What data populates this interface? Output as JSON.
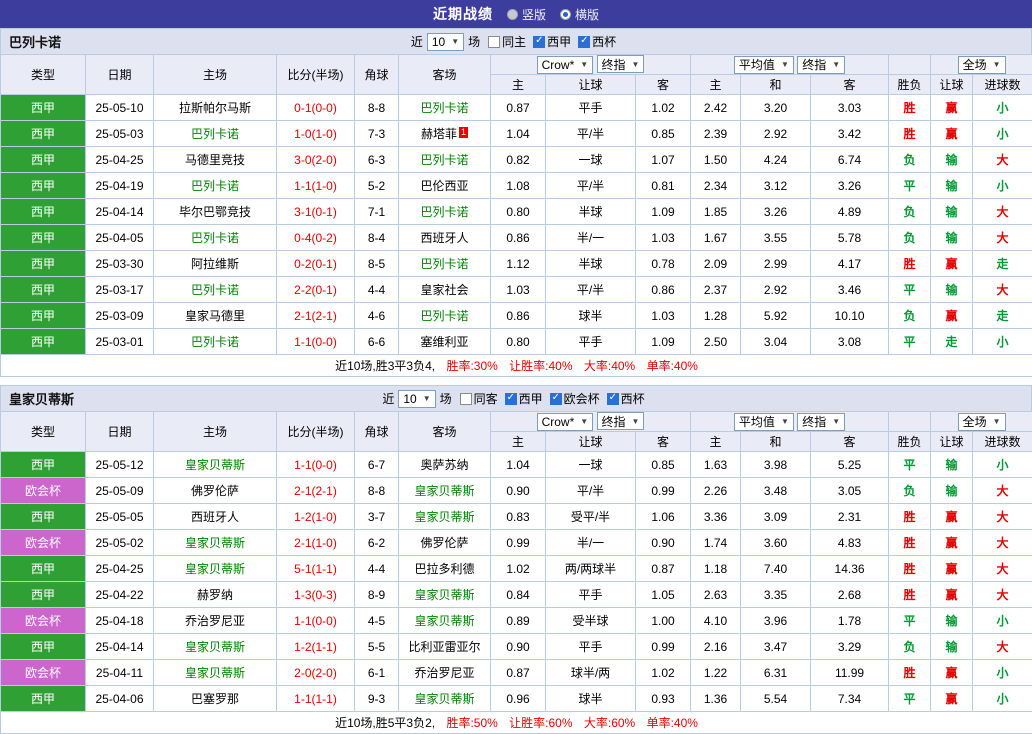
{
  "colors": {
    "topbar_bg": "#3d3d9e",
    "section_bar_bg": "#dde1ef",
    "header_bg": "#e9ebf7",
    "border": "#b8cce4",
    "league_green": "#2fa033",
    "league_purple": "#cc66cc",
    "focal_team": "#008000",
    "red": "#e60000",
    "green": "#009933"
  },
  "topbar": {
    "title": "近期战绩",
    "radios": [
      {
        "label": "竖版",
        "selected": false
      },
      {
        "label": "横版",
        "selected": true
      }
    ]
  },
  "sections": [
    {
      "team": "巴列卡诺",
      "filter": {
        "prefix": "近",
        "count": "10",
        "suffix": "场",
        "checkboxes": [
          {
            "label": "同主",
            "checked": false
          },
          {
            "label": "西甲",
            "checked": true
          },
          {
            "label": "西杯",
            "checked": true
          }
        ]
      },
      "header": {
        "cols": [
          "类型",
          "日期",
          "主场",
          "比分(半场)",
          "角球",
          "客场"
        ],
        "group1": {
          "select1": "Crow*",
          "select2": "终指",
          "cols": [
            "主",
            "让球",
            "客"
          ]
        },
        "group2": {
          "select1": "平均值",
          "select2": "终指",
          "cols": [
            "主",
            "和",
            "客"
          ]
        },
        "winlose": "胜负",
        "group3": {
          "select": "全场",
          "cols": [
            "让球",
            "进球数"
          ]
        }
      },
      "rows": [
        {
          "league": "西甲",
          "date": "25-05-10",
          "home": "拉斯帕尔马斯",
          "home_focal": false,
          "score": "0-1(0-0)",
          "corners": "8-8",
          "away": "巴列卡诺",
          "away_focal": true,
          "odds": [
            "0.87",
            "平手",
            "1.02"
          ],
          "avg": [
            "2.42",
            "3.20",
            "3.03"
          ],
          "result": "胜",
          "handicap": "赢",
          "goals": "小"
        },
        {
          "league": "西甲",
          "date": "25-05-03",
          "home": "巴列卡诺",
          "home_focal": true,
          "score": "1-0(1-0)",
          "corners": "7-3",
          "away": "赫塔菲",
          "away_focal": false,
          "away_card": "1",
          "odds": [
            "1.04",
            "平/半",
            "0.85"
          ],
          "avg": [
            "2.39",
            "2.92",
            "3.42"
          ],
          "result": "胜",
          "handicap": "赢",
          "goals": "小"
        },
        {
          "league": "西甲",
          "date": "25-04-25",
          "home": "马德里竞技",
          "home_focal": false,
          "score": "3-0(2-0)",
          "corners": "6-3",
          "away": "巴列卡诺",
          "away_focal": true,
          "odds": [
            "0.82",
            "一球",
            "1.07"
          ],
          "avg": [
            "1.50",
            "4.24",
            "6.74"
          ],
          "result": "负",
          "handicap": "输",
          "goals": "大"
        },
        {
          "league": "西甲",
          "date": "25-04-19",
          "home": "巴列卡诺",
          "home_focal": true,
          "score": "1-1(1-0)",
          "corners": "5-2",
          "away": "巴伦西亚",
          "away_focal": false,
          "odds": [
            "1.08",
            "平/半",
            "0.81"
          ],
          "avg": [
            "2.34",
            "3.12",
            "3.26"
          ],
          "result": "平",
          "handicap": "输",
          "goals": "小"
        },
        {
          "league": "西甲",
          "date": "25-04-14",
          "home": "毕尔巴鄂竞技",
          "home_focal": false,
          "score": "3-1(0-1)",
          "corners": "7-1",
          "away": "巴列卡诺",
          "away_focal": true,
          "odds": [
            "0.80",
            "半球",
            "1.09"
          ],
          "avg": [
            "1.85",
            "3.26",
            "4.89"
          ],
          "result": "负",
          "handicap": "输",
          "goals": "大"
        },
        {
          "league": "西甲",
          "date": "25-04-05",
          "home": "巴列卡诺",
          "home_focal": true,
          "score": "0-4(0-2)",
          "corners": "8-4",
          "away": "西班牙人",
          "away_focal": false,
          "odds": [
            "0.86",
            "半/一",
            "1.03"
          ],
          "avg": [
            "1.67",
            "3.55",
            "5.78"
          ],
          "result": "负",
          "handicap": "输",
          "goals": "大"
        },
        {
          "league": "西甲",
          "date": "25-03-30",
          "home": "阿拉维斯",
          "home_focal": false,
          "score": "0-2(0-1)",
          "corners": "8-5",
          "away": "巴列卡诺",
          "away_focal": true,
          "odds": [
            "1.12",
            "半球",
            "0.78"
          ],
          "avg": [
            "2.09",
            "2.99",
            "4.17"
          ],
          "result": "胜",
          "handicap": "赢",
          "goals": "走"
        },
        {
          "league": "西甲",
          "date": "25-03-17",
          "home": "巴列卡诺",
          "home_focal": true,
          "score": "2-2(0-1)",
          "corners": "4-4",
          "away": "皇家社会",
          "away_focal": false,
          "odds": [
            "1.03",
            "平/半",
            "0.86"
          ],
          "avg": [
            "2.37",
            "2.92",
            "3.46"
          ],
          "result": "平",
          "handicap": "输",
          "goals": "大"
        },
        {
          "league": "西甲",
          "date": "25-03-09",
          "home": "皇家马德里",
          "home_focal": false,
          "score": "2-1(2-1)",
          "corners": "4-6",
          "away": "巴列卡诺",
          "away_focal": true,
          "odds": [
            "0.86",
            "球半",
            "1.03"
          ],
          "avg": [
            "1.28",
            "5.92",
            "10.10"
          ],
          "result": "负",
          "handicap": "赢",
          "goals": "走"
        },
        {
          "league": "西甲",
          "date": "25-03-01",
          "home": "巴列卡诺",
          "home_focal": true,
          "score": "1-1(0-0)",
          "corners": "6-6",
          "away": "塞维利亚",
          "away_focal": false,
          "odds": [
            "0.80",
            "平手",
            "1.09"
          ],
          "avg": [
            "2.50",
            "3.04",
            "3.08"
          ],
          "result": "平",
          "handicap": "走",
          "goals": "小"
        }
      ],
      "footer": {
        "prefix": "近10场,胜3平3负4,",
        "stats": [
          "胜率:30%",
          "让胜率:40%",
          "大率:40%",
          "单率:40%"
        ]
      }
    },
    {
      "team": "皇家贝蒂斯",
      "filter": {
        "prefix": "近",
        "count": "10",
        "suffix": "场",
        "checkboxes": [
          {
            "label": "同客",
            "checked": false
          },
          {
            "label": "西甲",
            "checked": true
          },
          {
            "label": "欧会杯",
            "checked": true
          },
          {
            "label": "西杯",
            "checked": true
          }
        ]
      },
      "header": {
        "cols": [
          "类型",
          "日期",
          "主场",
          "比分(半场)",
          "角球",
          "客场"
        ],
        "group1": {
          "select1": "Crow*",
          "select2": "终指",
          "cols": [
            "主",
            "让球",
            "客"
          ]
        },
        "group2": {
          "select1": "平均值",
          "select2": "终指",
          "cols": [
            "主",
            "和",
            "客"
          ]
        },
        "winlose": "胜负",
        "group3": {
          "select": "全场",
          "cols": [
            "让球",
            "进球数"
          ]
        }
      },
      "rows": [
        {
          "league": "西甲",
          "date": "25-05-12",
          "home": "皇家贝蒂斯",
          "home_focal": true,
          "score": "1-1(0-0)",
          "corners": "6-7",
          "away": "奥萨苏纳",
          "away_focal": false,
          "odds": [
            "1.04",
            "一球",
            "0.85"
          ],
          "avg": [
            "1.63",
            "3.98",
            "5.25"
          ],
          "result": "平",
          "handicap": "输",
          "goals": "小"
        },
        {
          "league": "欧会杯",
          "date": "25-05-09",
          "home": "佛罗伦萨",
          "home_focal": false,
          "score": "2-1(2-1)",
          "corners": "8-8",
          "away": "皇家贝蒂斯",
          "away_focal": true,
          "odds": [
            "0.90",
            "平/半",
            "0.99"
          ],
          "avg": [
            "2.26",
            "3.48",
            "3.05"
          ],
          "result": "负",
          "handicap": "输",
          "goals": "大"
        },
        {
          "league": "西甲",
          "date": "25-05-05",
          "home": "西班牙人",
          "home_focal": false,
          "score": "1-2(1-0)",
          "corners": "3-7",
          "away": "皇家贝蒂斯",
          "away_focal": true,
          "odds": [
            "0.83",
            "受平/半",
            "1.06"
          ],
          "avg": [
            "3.36",
            "3.09",
            "2.31"
          ],
          "result": "胜",
          "handicap": "赢",
          "goals": "大"
        },
        {
          "league": "欧会杯",
          "date": "25-05-02",
          "home": "皇家贝蒂斯",
          "home_focal": true,
          "score": "2-1(1-0)",
          "corners": "6-2",
          "away": "佛罗伦萨",
          "away_focal": false,
          "odds": [
            "0.99",
            "半/一",
            "0.90"
          ],
          "avg": [
            "1.74",
            "3.60",
            "4.83"
          ],
          "result": "胜",
          "handicap": "赢",
          "goals": "大"
        },
        {
          "league": "西甲",
          "date": "25-04-25",
          "home": "皇家贝蒂斯",
          "home_focal": true,
          "score": "5-1(1-1)",
          "corners": "4-4",
          "away": "巴拉多利德",
          "away_focal": false,
          "odds": [
            "1.02",
            "两/两球半",
            "0.87"
          ],
          "avg": [
            "1.18",
            "7.40",
            "14.36"
          ],
          "result": "胜",
          "handicap": "赢",
          "goals": "大"
        },
        {
          "league": "西甲",
          "date": "25-04-22",
          "home": "赫罗纳",
          "home_focal": false,
          "score": "1-3(0-3)",
          "corners": "8-9",
          "away": "皇家贝蒂斯",
          "away_focal": true,
          "odds": [
            "0.84",
            "平手",
            "1.05"
          ],
          "avg": [
            "2.63",
            "3.35",
            "2.68"
          ],
          "result": "胜",
          "handicap": "赢",
          "goals": "大"
        },
        {
          "league": "欧会杯",
          "date": "25-04-18",
          "home": "乔治罗尼亚",
          "home_focal": false,
          "score": "1-1(0-0)",
          "corners": "4-5",
          "away": "皇家贝蒂斯",
          "away_focal": true,
          "odds": [
            "0.89",
            "受半球",
            "1.00"
          ],
          "avg": [
            "4.10",
            "3.96",
            "1.78"
          ],
          "result": "平",
          "handicap": "输",
          "goals": "小"
        },
        {
          "league": "西甲",
          "date": "25-04-14",
          "home": "皇家贝蒂斯",
          "home_focal": true,
          "score": "1-2(1-1)",
          "corners": "5-5",
          "away": "比利亚雷亚尔",
          "away_focal": false,
          "odds": [
            "0.90",
            "平手",
            "0.99"
          ],
          "avg": [
            "2.16",
            "3.47",
            "3.29"
          ],
          "result": "负",
          "handicap": "输",
          "goals": "大"
        },
        {
          "league": "欧会杯",
          "date": "25-04-11",
          "home": "皇家贝蒂斯",
          "home_focal": true,
          "score": "2-0(2-0)",
          "corners": "6-1",
          "away": "乔治罗尼亚",
          "away_focal": false,
          "odds": [
            "0.87",
            "球半/两",
            "1.02"
          ],
          "avg": [
            "1.22",
            "6.31",
            "11.99"
          ],
          "result": "胜",
          "handicap": "赢",
          "goals": "小"
        },
        {
          "league": "西甲",
          "date": "25-04-06",
          "home": "巴塞罗那",
          "home_focal": false,
          "score": "1-1(1-1)",
          "corners": "9-3",
          "away": "皇家贝蒂斯",
          "away_focal": true,
          "odds": [
            "0.96",
            "球半",
            "0.93"
          ],
          "avg": [
            "1.36",
            "5.54",
            "7.34"
          ],
          "result": "平",
          "handicap": "赢",
          "goals": "小"
        }
      ],
      "footer": {
        "prefix": "近10场,胜5平3负2,",
        "stats": [
          "胜率:50%",
          "让胜率:60%",
          "大率:60%",
          "单率:40%"
        ]
      }
    }
  ]
}
